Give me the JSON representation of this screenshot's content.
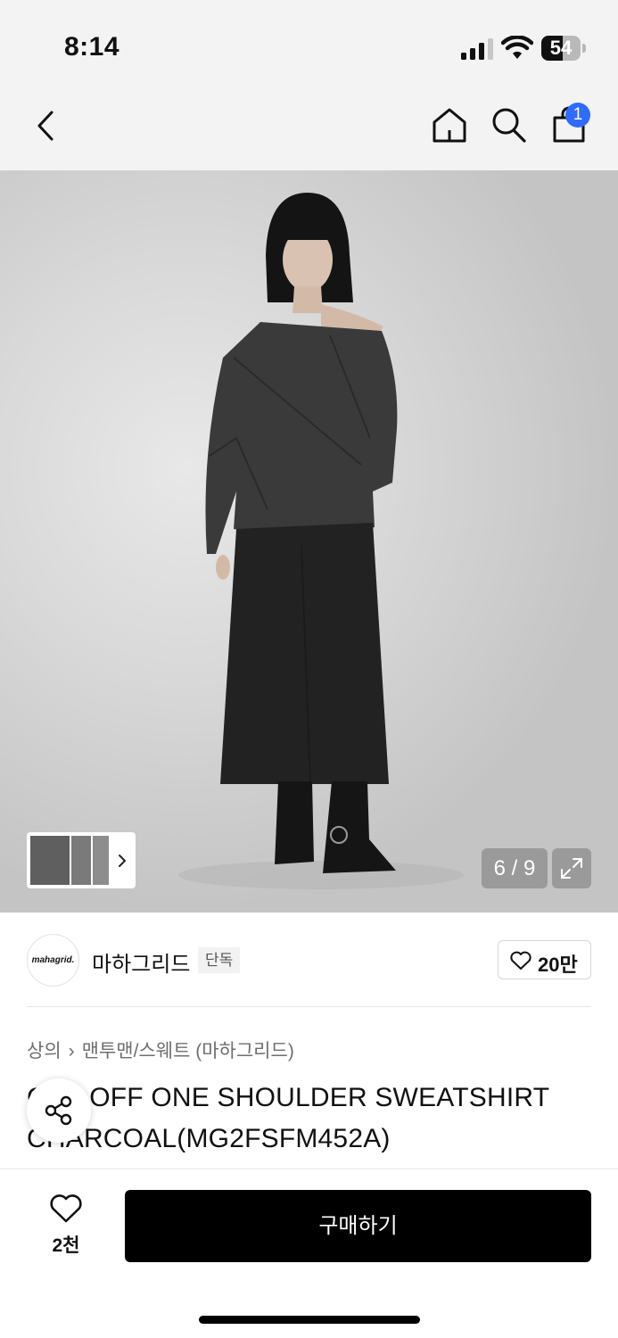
{
  "status_bar": {
    "time": "8:14",
    "battery": "54",
    "battery_level": 0.54
  },
  "nav": {
    "icons": [
      "back-icon",
      "home-icon",
      "search-icon",
      "shopping-bag-icon"
    ],
    "cart_count": "1"
  },
  "gallery": {
    "page_indicator": "6 / 9",
    "thumbnail_count": 3,
    "icons": [
      "chevron-right-icon",
      "expand-icon"
    ]
  },
  "brand": {
    "logo_text": "mahagrid.",
    "name": "마하그리드",
    "badge": "단독",
    "likes": "20만"
  },
  "breadcrumb": {
    "level1": "상의",
    "level2": "맨투맨/스웨트 (마하그리드)"
  },
  "product": {
    "title": "CUT OFF ONE SHOULDER SWEATSHIRT CHARCOAL(MG2FSFM452A)"
  },
  "bottom_bar": {
    "wish_count": "2천",
    "buy_label": "구매하기"
  },
  "colors": {
    "accent_badge": "#2f6bff",
    "buy_button": "#000000",
    "garment": "#3a3a3a",
    "skirt": "#222222"
  }
}
